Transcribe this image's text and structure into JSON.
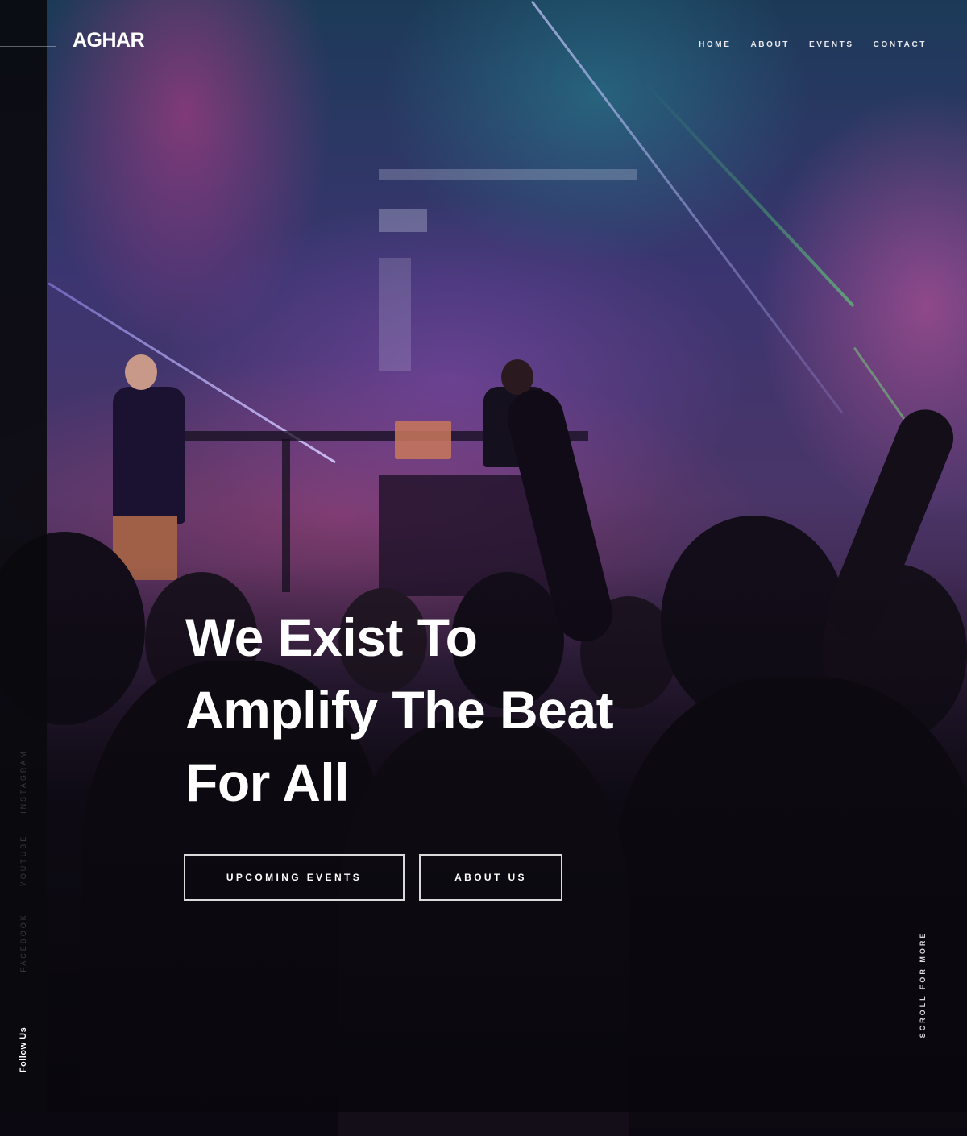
{
  "brand": {
    "logo_text": "AGHAR"
  },
  "nav": {
    "items": [
      {
        "label": "HOME"
      },
      {
        "label": "ABOUT"
      },
      {
        "label": "EVENTS"
      },
      {
        "label": "CONTACT"
      }
    ]
  },
  "hero": {
    "headline_lines": [
      "We Exist To",
      "Amplify The Beat",
      "For All"
    ],
    "buttons": {
      "events": "UPCOMING EVENTS",
      "about": "ABOUT US"
    },
    "scroll_label": "SCROLL FOR MORE"
  },
  "social": {
    "follow_label": "Follow Us",
    "links": [
      {
        "label": "INSTAGRAM"
      },
      {
        "label": "YOUTUBE"
      },
      {
        "label": "FACEBOOK"
      }
    ]
  },
  "colors": {
    "text": "#ffffff",
    "rail_bg": "#0a0a0e",
    "accent_pink": "#d0489a",
    "accent_teal": "#2a9aa0"
  }
}
